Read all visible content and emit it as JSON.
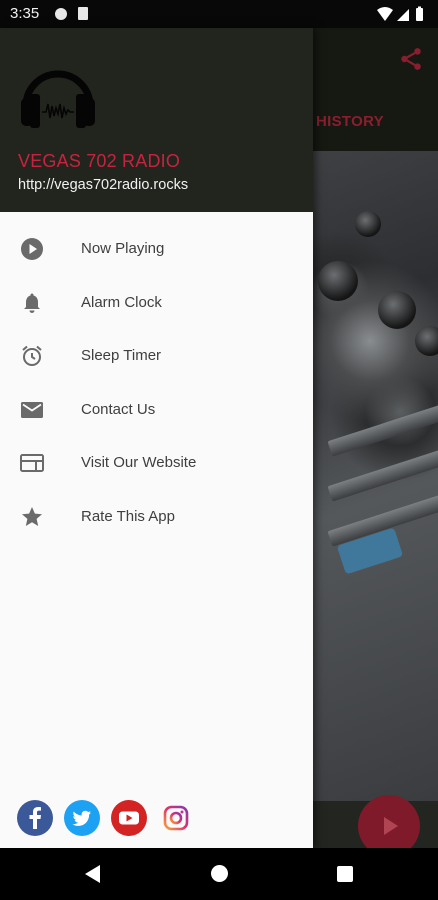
{
  "status_bar": {
    "time": "3:35"
  },
  "background_screen": {
    "tab_label": "HISTORY",
    "accent_color": "#8b1e2e"
  },
  "drawer": {
    "header": {
      "station_name": "VEGAS 702 RADIO",
      "station_url": "http://vegas702radio.rocks",
      "logo_icon": "headphones-icon"
    },
    "menu_items": [
      {
        "label": "Now Playing",
        "icon": "play-circle-icon"
      },
      {
        "label": "Alarm Clock",
        "icon": "bell-icon"
      },
      {
        "label": "Sleep Timer",
        "icon": "alarm-clock-icon"
      },
      {
        "label": "Contact Us",
        "icon": "mail-icon"
      },
      {
        "label": "Visit Our Website",
        "icon": "web-icon"
      },
      {
        "label": "Rate This App",
        "icon": "star-icon"
      }
    ],
    "social": [
      {
        "name": "facebook-icon",
        "color": "#3b5998"
      },
      {
        "name": "twitter-icon",
        "color": "#1da1f2"
      },
      {
        "name": "youtube-icon",
        "color": "#d32323"
      },
      {
        "name": "instagram-icon",
        "color": "#c13584"
      }
    ]
  },
  "colors": {
    "station_name": "#c8233e",
    "drawer_header_bg": "#22251e",
    "fab_bg": "#7e1a29"
  }
}
